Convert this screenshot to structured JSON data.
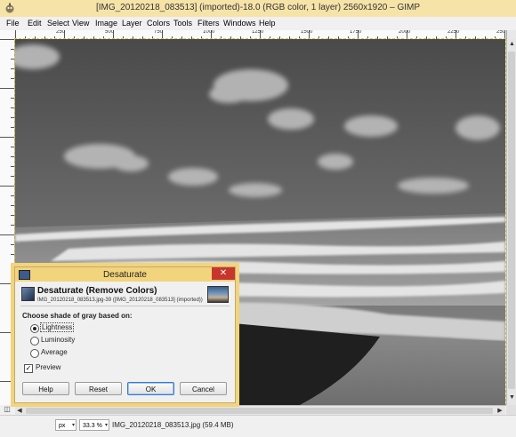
{
  "window": {
    "title": "[IMG_20120218_083513] (imported)-18.0 (RGB color, 1 layer) 2560x1920 – GIMP"
  },
  "menu": [
    "File",
    "Edit",
    "Select",
    "View",
    "Image",
    "Layer",
    "Colors",
    "Tools",
    "Filters",
    "Windows",
    "Help"
  ],
  "ruler": {
    "labels": [
      "250",
      "500",
      "750",
      "1000",
      "1250",
      "1500",
      "1750",
      "2000",
      "2250",
      "2500"
    ]
  },
  "dialog": {
    "title": "Desaturate",
    "heading": "Desaturate (Remove Colors)",
    "subtitle": "IMG_20120218_083513.jpg-39 ([IMG_20120218_083513] (imported))",
    "group_label": "Choose shade of gray based on:",
    "options": [
      {
        "label": "Lightness",
        "selected": true
      },
      {
        "label": "Luminosity",
        "selected": false
      },
      {
        "label": "Average",
        "selected": false
      }
    ],
    "preview_label": "Preview",
    "preview_checked": true,
    "buttons": {
      "help": "Help",
      "reset": "Reset",
      "ok": "OK",
      "cancel": "Cancel"
    },
    "close_glyph": "✕"
  },
  "statusbar": {
    "unit": "px",
    "zoom": "33.3 %",
    "info": "IMG_20120218_083513.jpg (59.4 MB)"
  },
  "colors": {
    "titlebar": "#f6e3a8",
    "dialog_frame": "#f2d47c",
    "close_button": "#c7362c"
  },
  "icons": {
    "app": "gimp-icon",
    "dialog": "desaturate-icon",
    "quickmask": "quick-mask-icon",
    "navigate": "navigate-icon"
  }
}
